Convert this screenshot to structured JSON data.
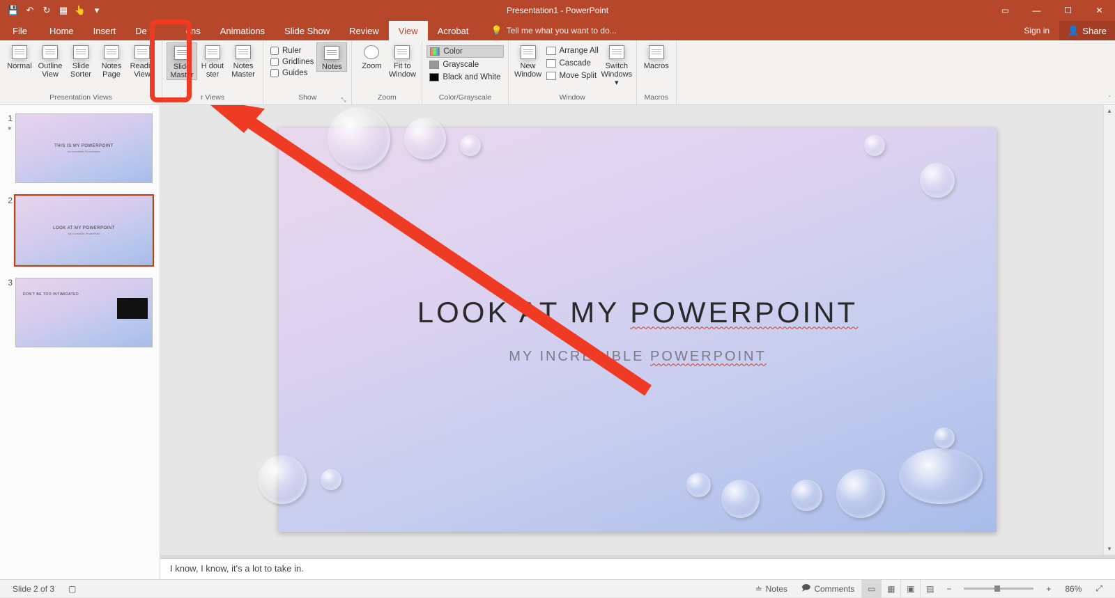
{
  "window": {
    "title": "Presentation1 - PowerPoint"
  },
  "qat": {
    "save": "💾",
    "undo": "↶",
    "redo": "↻",
    "start": "▦",
    "touch": "👆"
  },
  "tabs": {
    "file": "File",
    "items": [
      "Home",
      "Insert",
      "De",
      "ons",
      "Animations",
      "Slide Show",
      "Review",
      "View",
      "Acrobat"
    ],
    "active": "View",
    "tellme_placeholder": "Tell me what you want to do...",
    "signin": "Sign in",
    "share": "Share"
  },
  "ribbon": {
    "presentation_views": {
      "label": "Presentation Views",
      "normal": "Normal",
      "outline": "Outline\nView",
      "sorter": "Slide\nSorter",
      "notes": "Notes\nPage",
      "reading": "Readin\nView"
    },
    "master_views": {
      "label": "r Views",
      "slide_master": "Slide\nMaster",
      "handout": "H  dout\n  ster",
      "notes_master": "Notes\nMaster"
    },
    "show": {
      "label": "Show",
      "ruler": "Ruler",
      "gridlines": "Gridlines",
      "guides": "Guides",
      "notes_btn": "Notes"
    },
    "zoom": {
      "label": "Zoom",
      "zoom": "Zoom",
      "fit": "Fit to\nWindow"
    },
    "color": {
      "label": "Color/Grayscale",
      "color": "Color",
      "grayscale": "Grayscale",
      "bw": "Black and White"
    },
    "window": {
      "label": "Window",
      "new": "New\nWindow",
      "arrange": "Arrange All",
      "cascade": "Cascade",
      "split": "Move Split",
      "switch": "Switch\nWindows"
    },
    "macros": {
      "label": "Macros",
      "macros": "Macros"
    }
  },
  "thumbnails": [
    {
      "n": "1",
      "title": "THIS IS MY POWERPOINT",
      "sub": "An Incredible Presentation",
      "active": false,
      "star": true
    },
    {
      "n": "2",
      "title": "LOOK AT MY POWERPOINT",
      "sub": "My Incredible PowerPoint",
      "active": true,
      "star": false
    },
    {
      "n": "3",
      "title": "DON'T BE TOO INTIMIDATED",
      "sub": "",
      "active": false,
      "star": false,
      "has_img": true
    }
  ],
  "slide": {
    "title_a": "LOOK AT MY ",
    "title_b": "POWERPOINT",
    "sub_a": "MY INCREDIBLE ",
    "sub_b": "POWERPOINT"
  },
  "notes": {
    "text": "I know, I know, it's a lot to take in."
  },
  "status": {
    "slide": "Slide 2 of 3",
    "notes": "Notes",
    "comments": "Comments",
    "zoom": "86%"
  }
}
